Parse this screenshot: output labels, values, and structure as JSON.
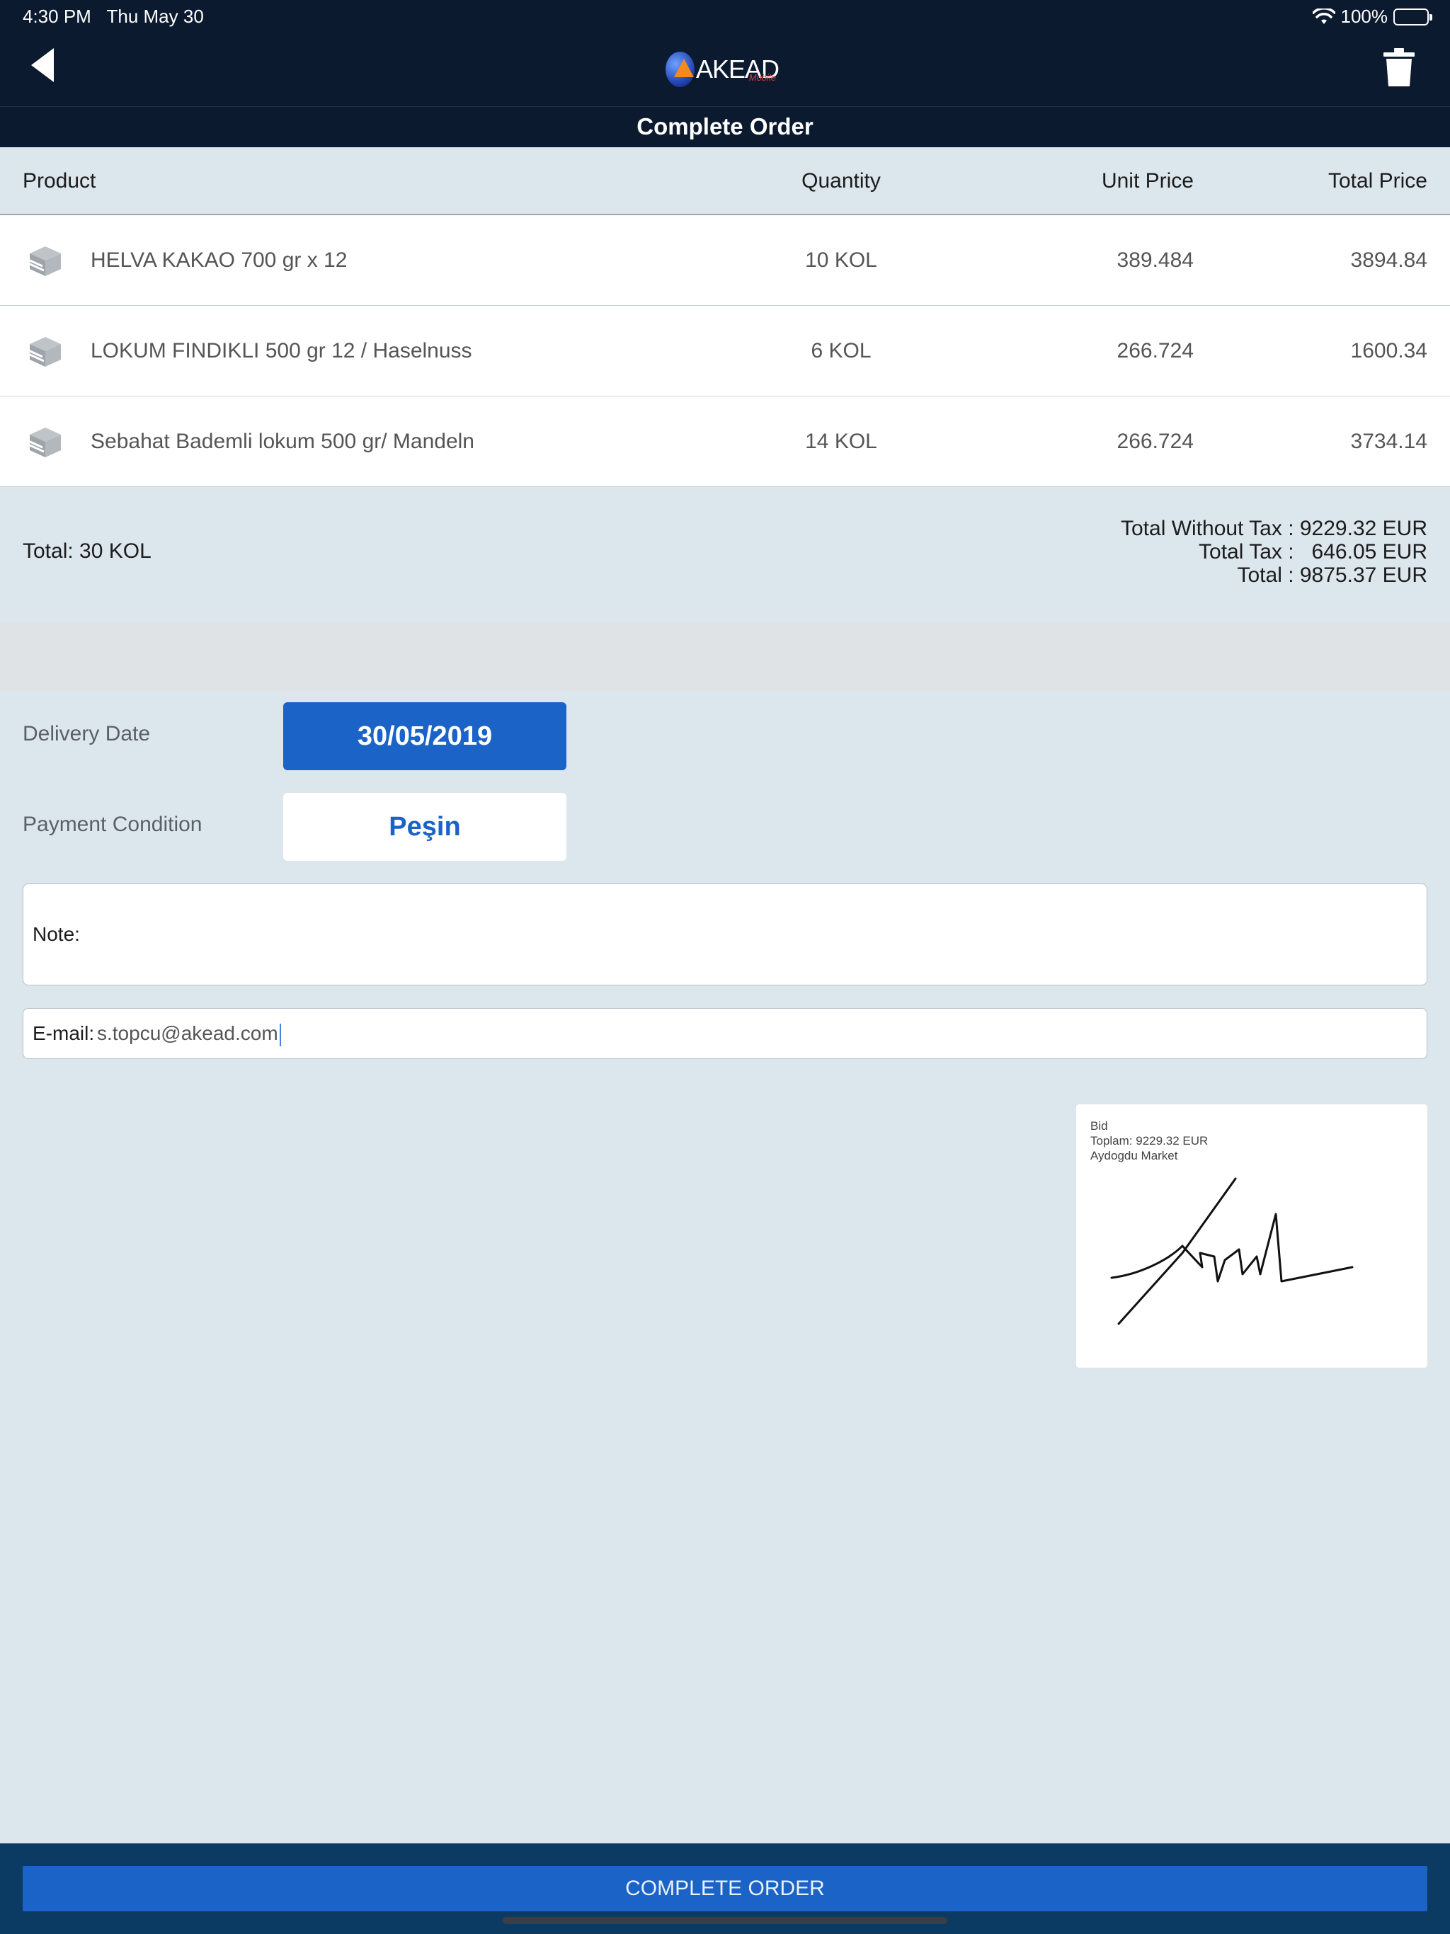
{
  "status_bar": {
    "time": "4:30 PM",
    "date": "Thu May 30",
    "battery": "100%"
  },
  "header": {
    "brand": "AKEAD",
    "brand_sub": "Mobile",
    "title": "Complete Order"
  },
  "table": {
    "columns": [
      "Product",
      "Quantity",
      "Unit Price",
      "Total Price"
    ],
    "rows": [
      {
        "product": "HELVA KAKAO 700 gr x 12",
        "quantity": "10 KOL",
        "unit_price": "389.484",
        "total_price": "3894.84"
      },
      {
        "product": "LOKUM FINDIKLI 500 gr 12 / Haselnuss",
        "quantity": "6 KOL",
        "unit_price": "266.724",
        "total_price": "1600.34"
      },
      {
        "product": "Sebahat Bademli lokum 500 gr/ Mandeln",
        "quantity": "14 KOL",
        "unit_price": "266.724",
        "total_price": "3734.14"
      }
    ]
  },
  "totals": {
    "quantity": "Total: 30 KOL",
    "without_tax": "Total Without Tax : 9229.32 EUR",
    "tax": "Total Tax :   646.05 EUR",
    "total": "Total : 9875.37 EUR"
  },
  "form": {
    "delivery_label": "Delivery Date",
    "delivery_value": "30/05/2019",
    "payment_label": "Payment Condition",
    "payment_value": "Peşin",
    "note_label": "Note:",
    "email_label": "E-mail:",
    "email_value": "s.topcu@akead.com"
  },
  "signature": {
    "line1": "Bid",
    "line2": "Toplam: 9229.32 EUR",
    "line3": "Aydogdu Market"
  },
  "footer": {
    "complete_label": "COMPLETE ORDER"
  }
}
